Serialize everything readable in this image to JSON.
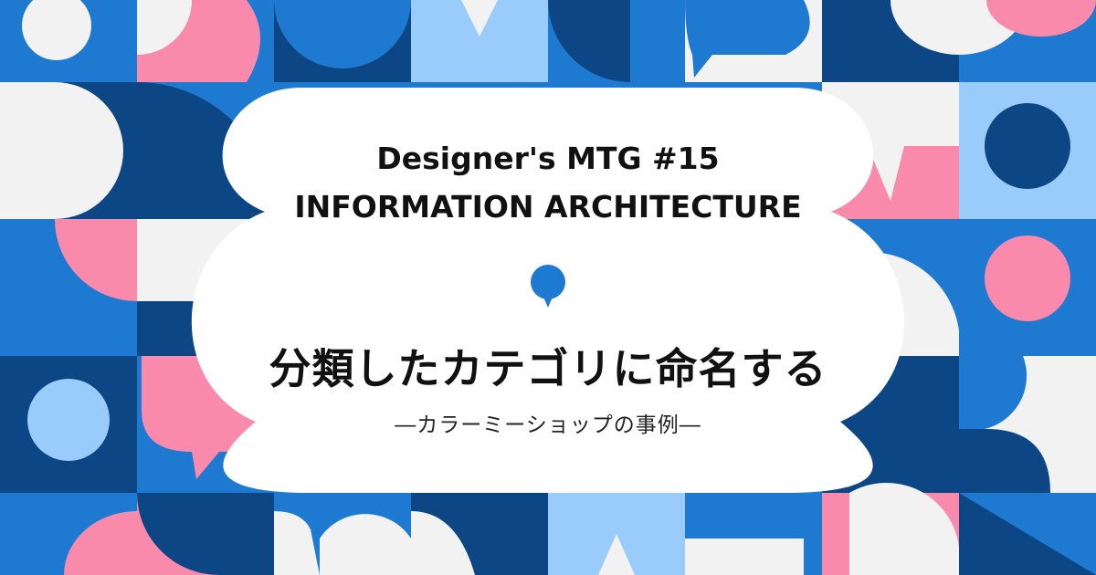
{
  "banner": {
    "series_title": "Designer's MTG #15",
    "theme_title": "INFORMATION ARCHITECTURE",
    "main_title": "分類したカテゴリに命名する",
    "subtitle": "―カラーミーショップの事例―"
  },
  "colors": {
    "navy": "#0c4684",
    "blue": "#1e7ad0",
    "light_blue": "#99ccfa",
    "pink": "#f98aab",
    "off_white": "#f2f2f2",
    "card": "#ffffff",
    "text": "#111111"
  },
  "icons": {
    "center_marker": "location-pin-icon"
  }
}
